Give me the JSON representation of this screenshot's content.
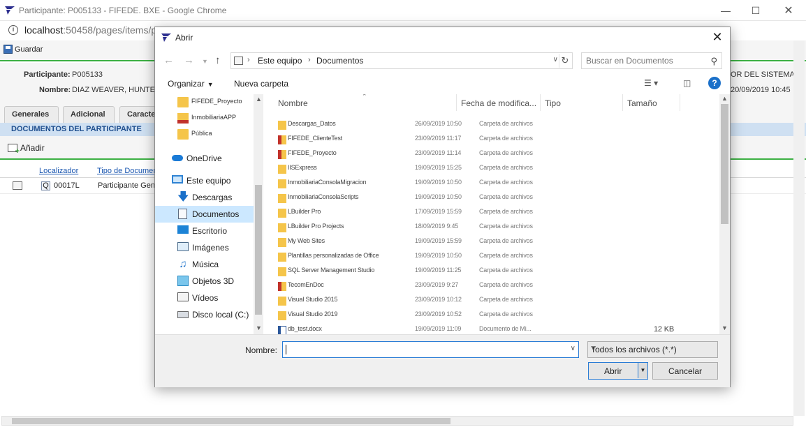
{
  "browser": {
    "title": "Participante: P005133 - FIFEDE. BXE - Google Chrome",
    "url_host": "localhost",
    "url_path": ":50458/pages/items/p"
  },
  "page": {
    "save_label": "Guardar",
    "participant_label": "Participante:",
    "participant_value": "P005133",
    "name_label": "Nombre:",
    "name_value": "DIAZ WEAVER, HUNTE",
    "system_text": "OR DEL SISTEMA",
    "date_text": "20/09/2019 10:45",
    "tabs": [
      "Generales",
      "Adicional",
      "Caracte"
    ],
    "section_title": "DOCUMENTOS DEL PARTICIPANTE",
    "add_label": "Añadir",
    "grid_headers": [
      "Localizador",
      "Tipo de Documen"
    ],
    "row": {
      "locator": "00017L",
      "doc_type": "Participante Gen"
    }
  },
  "dialog": {
    "title": "Abrir",
    "path": [
      "Este equipo",
      "Documentos"
    ],
    "search_placeholder": "Buscar en Documentos",
    "organize_label": "Organizar",
    "new_folder_label": "Nueva carpeta",
    "nav_items": [
      {
        "label": "FIFEDE_Proyecto",
        "icon": "folder-icon"
      },
      {
        "label": "InmobiliariaAPP",
        "icon": "folder-locked-icon"
      },
      {
        "label": "Pública",
        "icon": "folder-icon"
      },
      {
        "label": "OneDrive",
        "icon": "cloud-icon"
      },
      {
        "label": "Este equipo",
        "icon": "computer-icon"
      },
      {
        "label": "Descargas",
        "icon": "download-icon"
      },
      {
        "label": "Documentos",
        "icon": "document-folder-icon"
      },
      {
        "label": "Escritorio",
        "icon": "desktop-icon"
      },
      {
        "label": "Imágenes",
        "icon": "pictures-icon"
      },
      {
        "label": "Música",
        "icon": "music-icon"
      },
      {
        "label": "Objetos 3D",
        "icon": "cube-icon"
      },
      {
        "label": "Vídeos",
        "icon": "video-icon"
      },
      {
        "label": "Disco local (C:)",
        "icon": "disk-icon"
      }
    ],
    "columns": [
      "Nombre",
      "Fecha de modifica...",
      "Tipo",
      "Tamaño"
    ],
    "files": [
      {
        "name": "Descargas_Datos",
        "date": "26/09/2019 10:50",
        "type": "Carpeta de archivos",
        "size": "",
        "icon": "folder"
      },
      {
        "name": "FIFEDE_ClienteTest",
        "date": "23/09/2019 11:17",
        "type": "Carpeta de archivos",
        "size": "",
        "icon": "folder-red"
      },
      {
        "name": "FIFEDE_Proyecto",
        "date": "23/09/2019 11:14",
        "type": "Carpeta de archivos",
        "size": "",
        "icon": "folder-red"
      },
      {
        "name": "IISExpress",
        "date": "19/09/2019 15:25",
        "type": "Carpeta de archivos",
        "size": "",
        "icon": "folder"
      },
      {
        "name": "InmobiliariaConsolaMigracion",
        "date": "19/09/2019 10:50",
        "type": "Carpeta de archivos",
        "size": "",
        "icon": "folder"
      },
      {
        "name": "InmobiliariaConsolaScripts",
        "date": "19/09/2019 10:50",
        "type": "Carpeta de archivos",
        "size": "",
        "icon": "folder"
      },
      {
        "name": "LBuilder Pro",
        "date": "17/09/2019 15:59",
        "type": "Carpeta de archivos",
        "size": "",
        "icon": "folder"
      },
      {
        "name": "LBuilder Pro Projects",
        "date": "18/09/2019 9:45",
        "type": "Carpeta de archivos",
        "size": "",
        "icon": "folder"
      },
      {
        "name": "My Web Sites",
        "date": "19/09/2019 15:59",
        "type": "Carpeta de archivos",
        "size": "",
        "icon": "folder"
      },
      {
        "name": "Plantillas personalizadas de Office",
        "date": "19/09/2019 10:50",
        "type": "Carpeta de archivos",
        "size": "",
        "icon": "folder"
      },
      {
        "name": "SQL Server Management Studio",
        "date": "19/09/2019 11:25",
        "type": "Carpeta de archivos",
        "size": "",
        "icon": "folder"
      },
      {
        "name": "TecomEnDoc",
        "date": "23/09/2019 9:27",
        "type": "Carpeta de archivos",
        "size": "",
        "icon": "folder-red"
      },
      {
        "name": "Visual Studio 2015",
        "date": "23/09/2019 10:12",
        "type": "Carpeta de archivos",
        "size": "",
        "icon": "folder"
      },
      {
        "name": "Visual Studio 2019",
        "date": "23/09/2019 10:52",
        "type": "Carpeta de archivos",
        "size": "",
        "icon": "folder"
      },
      {
        "name": "db_test.docx",
        "date": "19/09/2019 11:09",
        "type": "Documento de Mi...",
        "size": "12 KB",
        "icon": "doc"
      }
    ],
    "name_label": "Nombre:",
    "name_value": "",
    "filter_value": "Todos los archivos (*.*)",
    "open_label": "Abrir",
    "cancel_label": "Cancelar"
  }
}
